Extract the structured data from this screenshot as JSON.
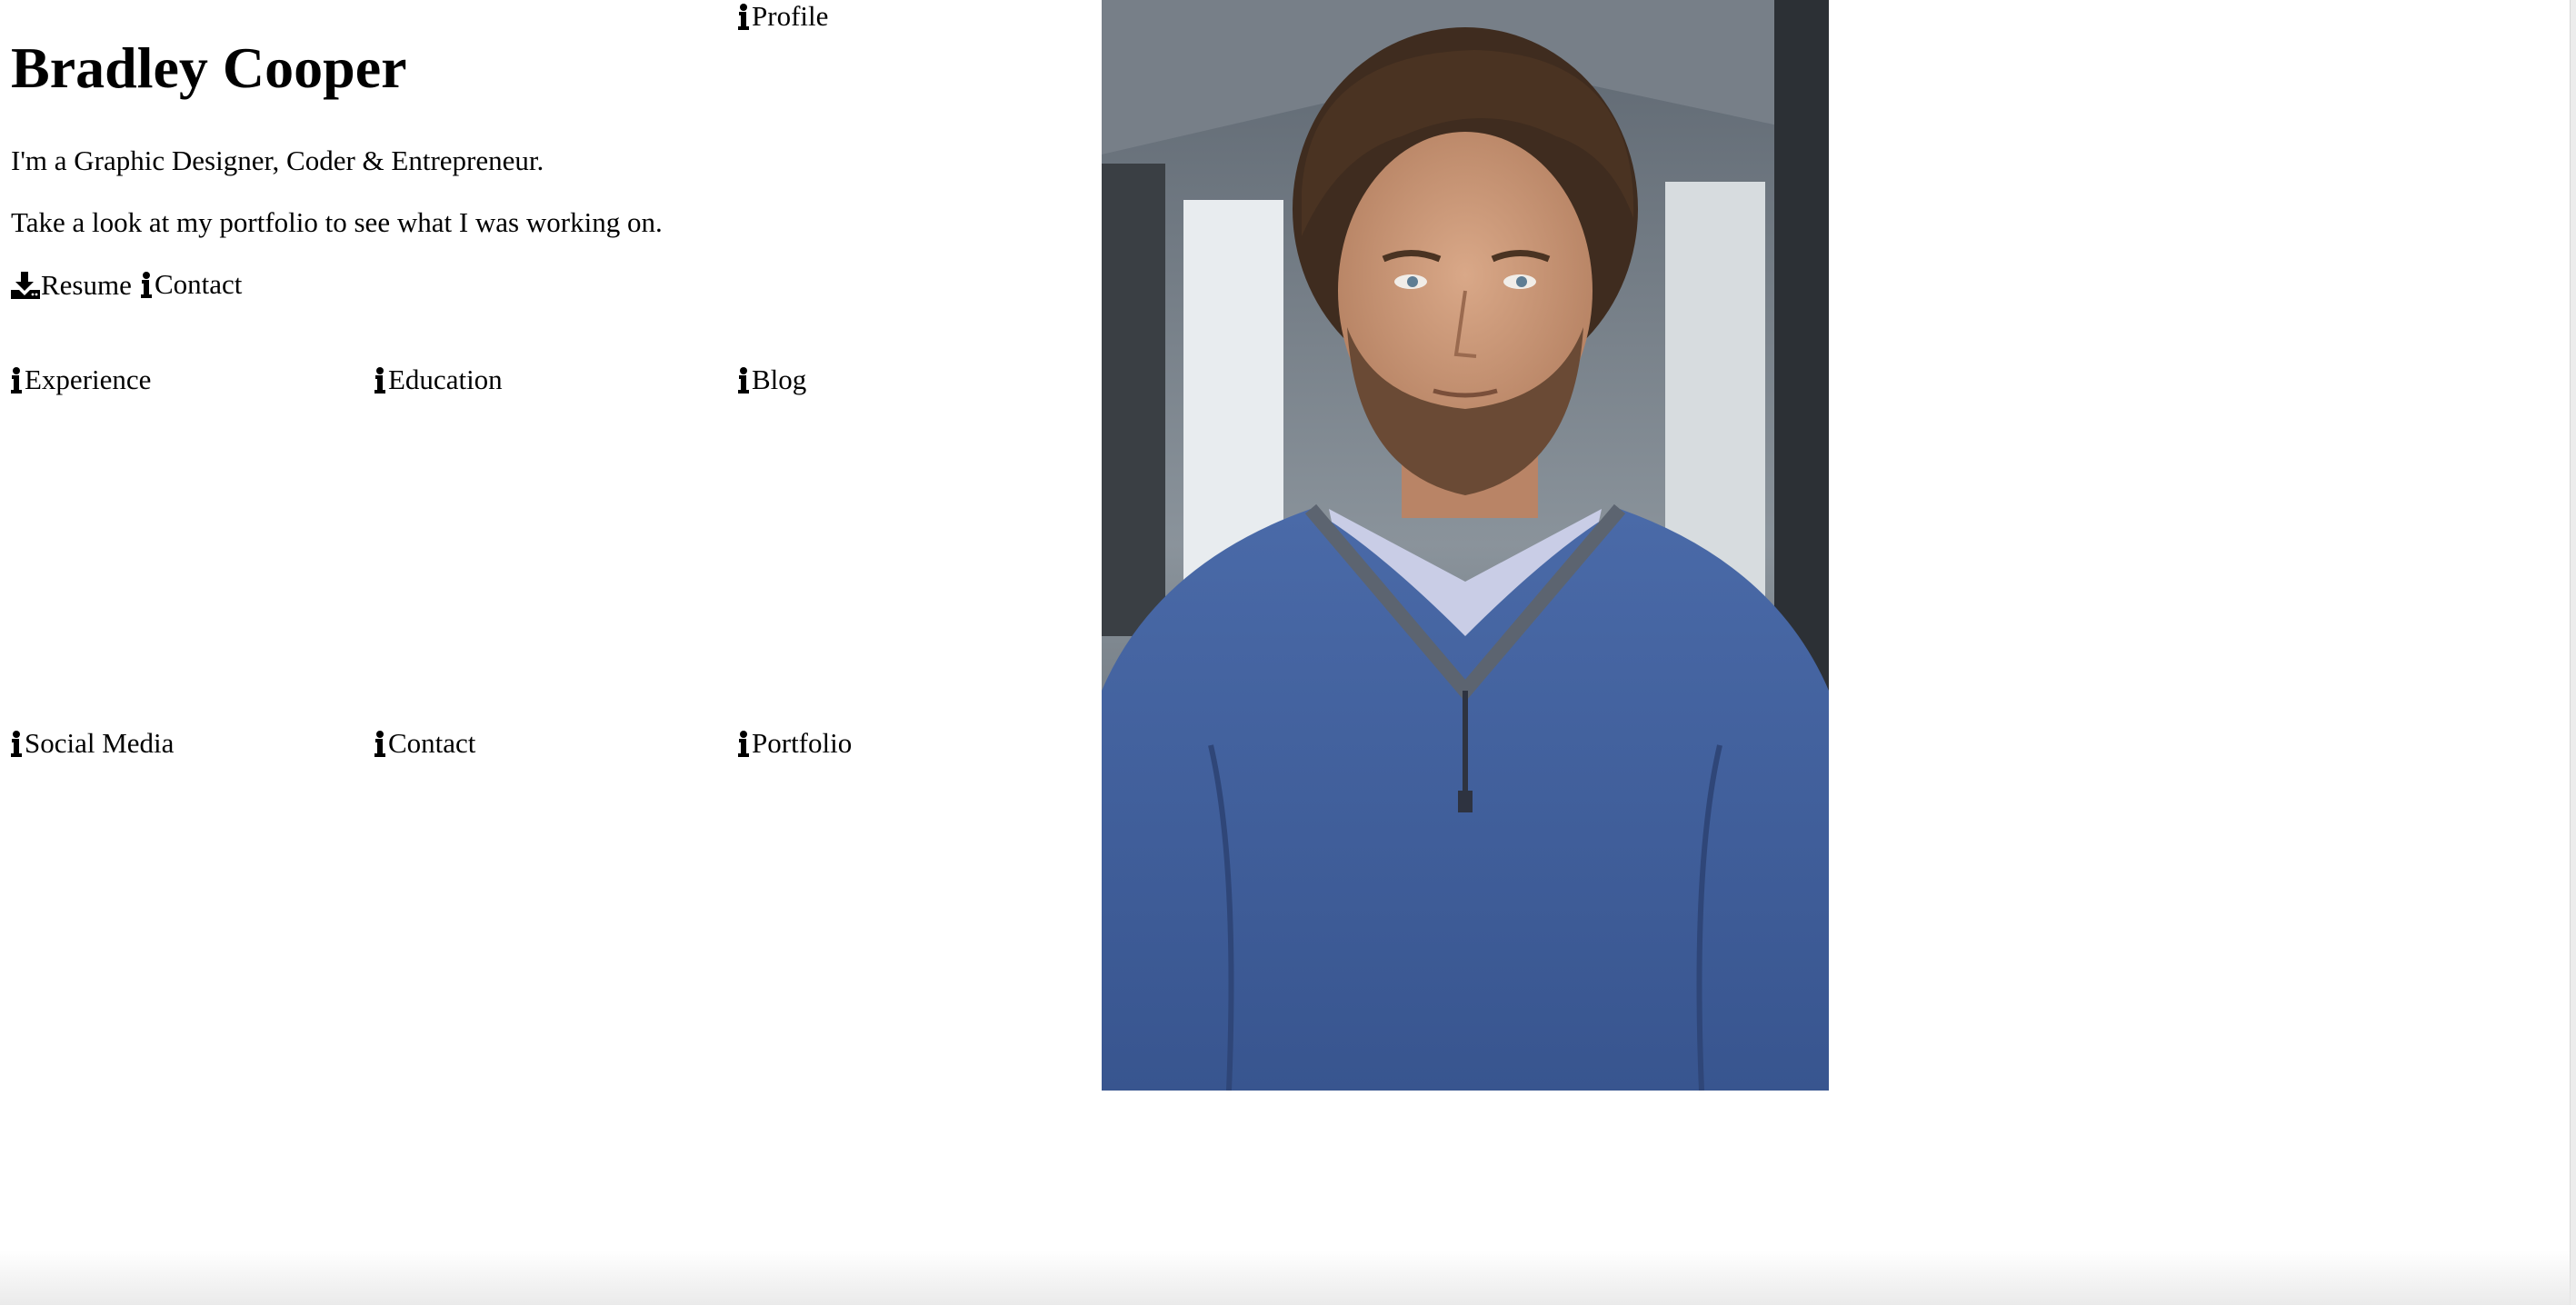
{
  "profile": {
    "title": "Bradley Cooper"
  },
  "intro": {
    "line1": "I'm a Graphic Designer, Coder & Entrepreneur.",
    "line2": "Take a look at my portfolio to see what I was working on."
  },
  "nav": {
    "profile": "Profile",
    "resume": "Resume",
    "contact_top": "Contact",
    "experience": "Experience",
    "education": "Education",
    "blog": "Blog",
    "social_media": "Social Media",
    "contact": "Contact",
    "portfolio": "Portfolio"
  },
  "icons": {
    "info": "info-icon",
    "download": "download-icon"
  }
}
